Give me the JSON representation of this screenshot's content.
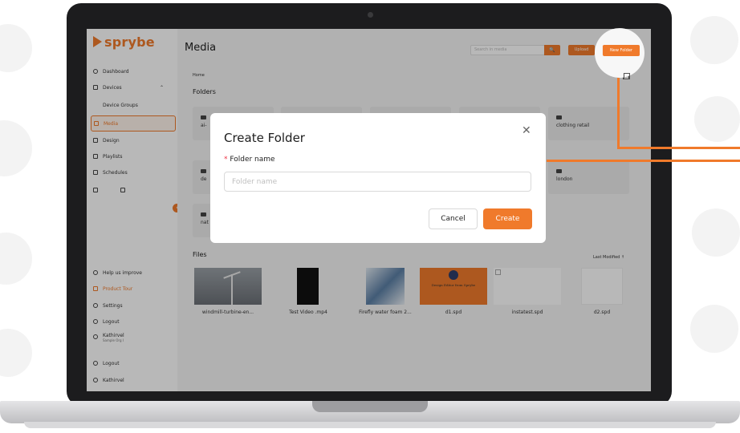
{
  "app": {
    "logo_text": "sprybe",
    "brand_color": "#f07a2b"
  },
  "sidebar": {
    "items": [
      {
        "label": "Dashboard",
        "icon": "clock-icon"
      },
      {
        "label": "Devices",
        "icon": "devices-icon",
        "chevron": "⌃"
      },
      {
        "label": "Device Groups"
      },
      {
        "label": "Media",
        "icon": "media-icon",
        "active": true
      },
      {
        "label": "Design",
        "icon": "design-icon"
      },
      {
        "label": "Playlists",
        "icon": "playlist-icon"
      },
      {
        "label": "Schedules",
        "icon": "calendar-icon"
      }
    ],
    "bottom": [
      {
        "label": "Help us improve",
        "icon": "help-icon"
      },
      {
        "label": "Product Tour",
        "icon": "tour-icon"
      },
      {
        "label": "Settings",
        "icon": "gear-icon"
      },
      {
        "label": "Logout",
        "icon": "logout-icon"
      }
    ],
    "user": {
      "name": "Kathirvel",
      "org": "Sample Org I"
    },
    "bottom2": [
      {
        "label": "Logout"
      },
      {
        "label": "Kathirvel"
      }
    ]
  },
  "header": {
    "title": "Media",
    "search_placeholder": "Search in media",
    "search_icon": "🔍",
    "upload_label": "Upload",
    "new_folder_label": "New Folder"
  },
  "main": {
    "breadcrumb": "Home",
    "folders_title": "Folders",
    "folders": [
      {
        "name": "ai-"
      },
      {
        "name": "de"
      },
      {
        "name": "nat"
      },
      {
        "name": "clothing retail"
      },
      {
        "name": "london"
      }
    ],
    "files_title": "Files",
    "sort_label": "Last Modified ↑",
    "files": [
      {
        "name": "windmill-turbine-en..."
      },
      {
        "name": "Test Video .mp4"
      },
      {
        "name": "Firefly water foam 2..."
      },
      {
        "name": "d1.spd",
        "thumb_text": "Design Editor from Sprybe"
      },
      {
        "name": "instatest.spd"
      },
      {
        "name": "d2.spd"
      }
    ]
  },
  "modal": {
    "title": "Create Folder",
    "close_glyph": "✕",
    "field_label": "Folder name",
    "required_mark": "*",
    "field_value": "",
    "field_placeholder": "Folder name",
    "cancel_label": "Cancel",
    "create_label": "Create"
  }
}
